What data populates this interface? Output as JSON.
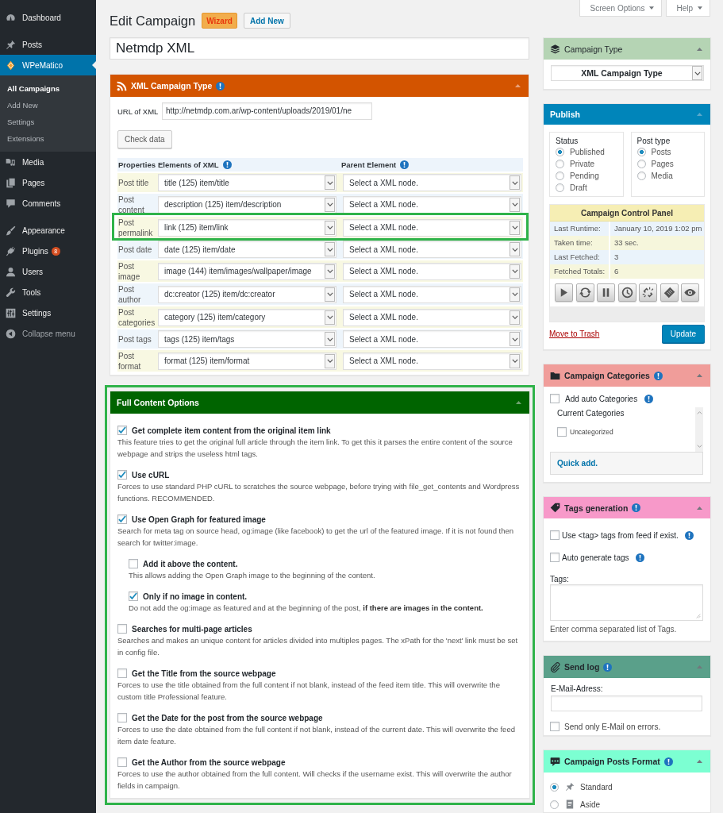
{
  "sidebar": {
    "groups": [
      {
        "items": [
          {
            "label": "Dashboard",
            "selected": false
          }
        ]
      },
      {
        "items": [
          {
            "label": "Posts",
            "selected": false
          },
          {
            "label": "WPeMatico",
            "selected": true,
            "children": [
              {
                "label": "All Campaigns",
                "selected": true
              },
              {
                "label": "Add New",
                "selected": false
              },
              {
                "label": "Settings",
                "selected": false
              },
              {
                "label": "Extensions",
                "selected": false
              }
            ]
          },
          {
            "label": "Media",
            "selected": false
          },
          {
            "label": "Pages",
            "selected": false
          },
          {
            "label": "Comments",
            "selected": false
          }
        ]
      },
      {
        "items": [
          {
            "label": "Appearance",
            "selected": false
          },
          {
            "label": "Plugins",
            "selected": false,
            "badge": "8"
          },
          {
            "label": "Users",
            "selected": false
          },
          {
            "label": "Tools",
            "selected": false
          },
          {
            "label": "Settings",
            "selected": false
          }
        ]
      }
    ],
    "collapse": "Collapse menu"
  },
  "screen_tabs": [
    "Screen Options",
    "Help"
  ],
  "header": {
    "title": "Edit Campaign",
    "buttons": [
      {
        "label": "Wizard",
        "kind": "wizard"
      },
      {
        "label": "Add New",
        "kind": "secondary"
      }
    ]
  },
  "title_field": {
    "value": "Netmdp XML"
  },
  "xml_campaign_type": {
    "title": "XML Campaign Type",
    "info": true,
    "url_label": "URL of XML",
    "url_value": "http://netmdp.com.ar/wp-content/uploads/2019/01/ne",
    "check_button": "Check data",
    "table": {
      "columns": [
        {
          "label": "Properties",
          "info": false
        },
        {
          "label": "Elements of XML",
          "info": true
        },
        {
          "label": "Parent Element",
          "info": true
        }
      ],
      "rows": [
        {
          "property": "Post title",
          "element": "title (125) item/title",
          "parent": "Select a XML node.",
          "highlighted": false
        },
        {
          "property": "Post content",
          "element": "description (125) item/description",
          "parent": "Select a XML node.",
          "highlighted": false
        },
        {
          "property": "Post permalink",
          "element": "link (125) item/link",
          "parent": "Select a XML node.",
          "highlighted": true
        },
        {
          "property": "Post date",
          "element": "date (125) item/date",
          "parent": "Select a XML node.",
          "highlighted": false
        },
        {
          "property": "Post image",
          "element": "image (144) item/images/wallpaper/image",
          "parent": "Select a XML node.",
          "highlighted": false
        },
        {
          "property": "Post author",
          "element": "dc:creator (125) item/dc:creator",
          "parent": "Select a XML node.",
          "highlighted": false
        },
        {
          "property": "Post categories",
          "element": "category (125) item/category",
          "parent": "Select a XML node.",
          "highlighted": false
        },
        {
          "property": "Post tags",
          "element": "tags (125) item/tags",
          "parent": "Select a XML node.",
          "highlighted": false
        },
        {
          "property": "Post format",
          "element": "format (125) item/format",
          "parent": "Select a XML node.",
          "highlighted": false
        }
      ]
    }
  },
  "full_content": {
    "title": "Full Content Options",
    "highlighted": true,
    "options": [
      {
        "label": "Get complete item content from the original item link",
        "description": "This feature tries to get the original full article through the item link. To get this it parses the entire content of the source webpage and strips the useless html tags.",
        "checked": true
      },
      {
        "label": "Use cURL",
        "description": "Forces to use standard PHP cURL to scratches the source webpage, before trying with file_get_contents and Wordpress functions. RECOMMENDED.",
        "checked": true
      },
      {
        "label": "Use Open Graph for featured image",
        "description": "Search for meta tag on source head, og:image (like facebook) to get the url of the featured image. If it is not found then search for twitter:image.",
        "checked": true,
        "children": [
          {
            "label": "Add it above the content.",
            "description": "This allows adding the Open Graph image to the beginning of the content.",
            "checked": false
          },
          {
            "label": "Only if no image in content.",
            "description": "Do not add the og:image as featured and at the beginning of the post, **if there are images in the content.**",
            "checked": true
          }
        ]
      },
      {
        "label": "Searches for multi-page articles",
        "description": "Searches and makes an unique content for articles divided into multiples pages. The xPath for the 'next' link must be set in config file.",
        "checked": false
      },
      {
        "label": "Get the Title from the source webpage",
        "description": "Forces to use the title obtained from the full content if not blank, instead of the feed item title. This will overwrite the custom title Professional feature.",
        "checked": false
      },
      {
        "label": "Get the Date for the post from the source webpage",
        "description": "Forces to use the date obtained from the full content if not blank, instead of the current date. This will overwrite the feed item date feature.",
        "checked": false
      },
      {
        "label": "Get the Author from the source webpage",
        "description": "Forces to use the author obtained from the full content. Will checks if the username exist. This will overwrite the author fields in campaign.",
        "checked": false
      }
    ]
  },
  "campaign_type": {
    "title": "Campaign Type",
    "value": "XML Campaign Type"
  },
  "publish": {
    "title": "Publish",
    "status": {
      "label": "Status",
      "options": [
        {
          "label": "Published",
          "selected": true
        },
        {
          "label": "Private",
          "selected": false
        },
        {
          "label": "Pending",
          "selected": false
        },
        {
          "label": "Draft",
          "selected": false
        }
      ]
    },
    "post_type": {
      "label": "Post type",
      "options": [
        {
          "label": "Posts",
          "selected": true
        },
        {
          "label": "Pages",
          "selected": false
        },
        {
          "label": "Media",
          "selected": false
        }
      ]
    },
    "control_panel": {
      "title": "Campaign Control Panel",
      "rows": [
        {
          "label": "Last Runtime:",
          "value": "January 10, 2019 1:02 pm"
        },
        {
          "label": "Taken time:",
          "value": "33 sec."
        },
        {
          "label": "Last Fetched:",
          "value": "3"
        },
        {
          "label": "Fetched Totals:",
          "value": "6"
        }
      ]
    },
    "trash_link": "Move to Trash",
    "update_button": "Update"
  },
  "categories": {
    "title": "Campaign Categories",
    "info": true,
    "auto": {
      "label": "Add auto Categories",
      "checked": false,
      "info": true
    },
    "list_title": "Current Categories",
    "items": [
      {
        "label": "Uncategorized",
        "checked": false
      }
    ],
    "quick_add": "Quick add."
  },
  "tags": {
    "title": "Tags generation",
    "info": true,
    "options": [
      {
        "label": "Use <tag> tags from feed if exist.",
        "checked": false,
        "info": true
      },
      {
        "label": "Auto generate tags",
        "checked": false,
        "info": true
      }
    ],
    "field_label": "Tags:",
    "hint": "Enter comma separated list of Tags."
  },
  "send_log": {
    "title": "Send log",
    "info": true,
    "field_label": "E-Mail-Adress:",
    "errors_only": {
      "label": "Send only E-Mail on errors.",
      "checked": false
    }
  },
  "posts_format": {
    "title": "Campaign Posts Format",
    "info": true,
    "options": [
      {
        "label": "Standard",
        "selected": true
      },
      {
        "label": "Aside",
        "selected": false
      }
    ]
  }
}
